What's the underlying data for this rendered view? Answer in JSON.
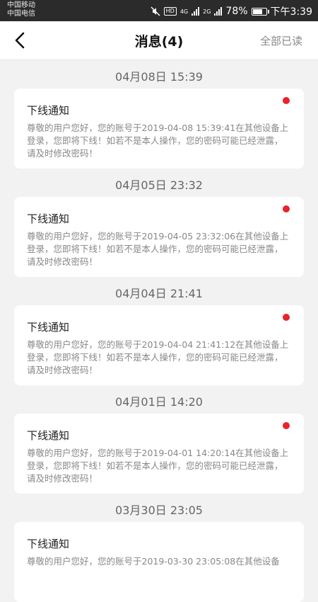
{
  "status": {
    "carrier1": "中国移动",
    "carrier2": "中国电信",
    "hd": "HD",
    "net1": "4G",
    "net2": "2G",
    "battery_text": "78%",
    "battery_level": 0.78,
    "time": "下午3:39"
  },
  "header": {
    "title": "消息(4)",
    "mark_all": "全部已读"
  },
  "messages": [
    {
      "time": "04月08日  15:39",
      "title": "下线通知",
      "body": "尊敬的用户您好，您的账号于2019-04-08 15:39:41在其他设备上登录，您即将下线！如若不是本人操作，您的密码可能已经泄露，请及时修改密码！",
      "unread": true
    },
    {
      "time": "04月05日  23:32",
      "title": "下线通知",
      "body": "尊敬的用户您好，您的账号于2019-04-05 23:32:06在其他设备上登录，您即将下线！如若不是本人操作，您的密码可能已经泄露，请及时修改密码！",
      "unread": true
    },
    {
      "time": "04月04日  21:41",
      "title": "下线通知",
      "body": "尊敬的用户您好，您的账号于2019-04-04 21:41:12在其他设备上登录，您即将下线！如若不是本人操作，您的密码可能已经泄露，请及时修改密码！",
      "unread": true
    },
    {
      "time": "04月01日  14:20",
      "title": "下线通知",
      "body": "尊敬的用户您好，您的账号于2019-04-01 14:20:14在其他设备上登录，您即将下线！如若不是本人操作，您的密码可能已经泄露，请及时修改密码！",
      "unread": true
    },
    {
      "time": "03月30日  23:05",
      "title": "下线通知",
      "body": "尊敬的用户您好，您的账号于2019-03-30 23:05:08在其他设备",
      "unread": false
    }
  ]
}
